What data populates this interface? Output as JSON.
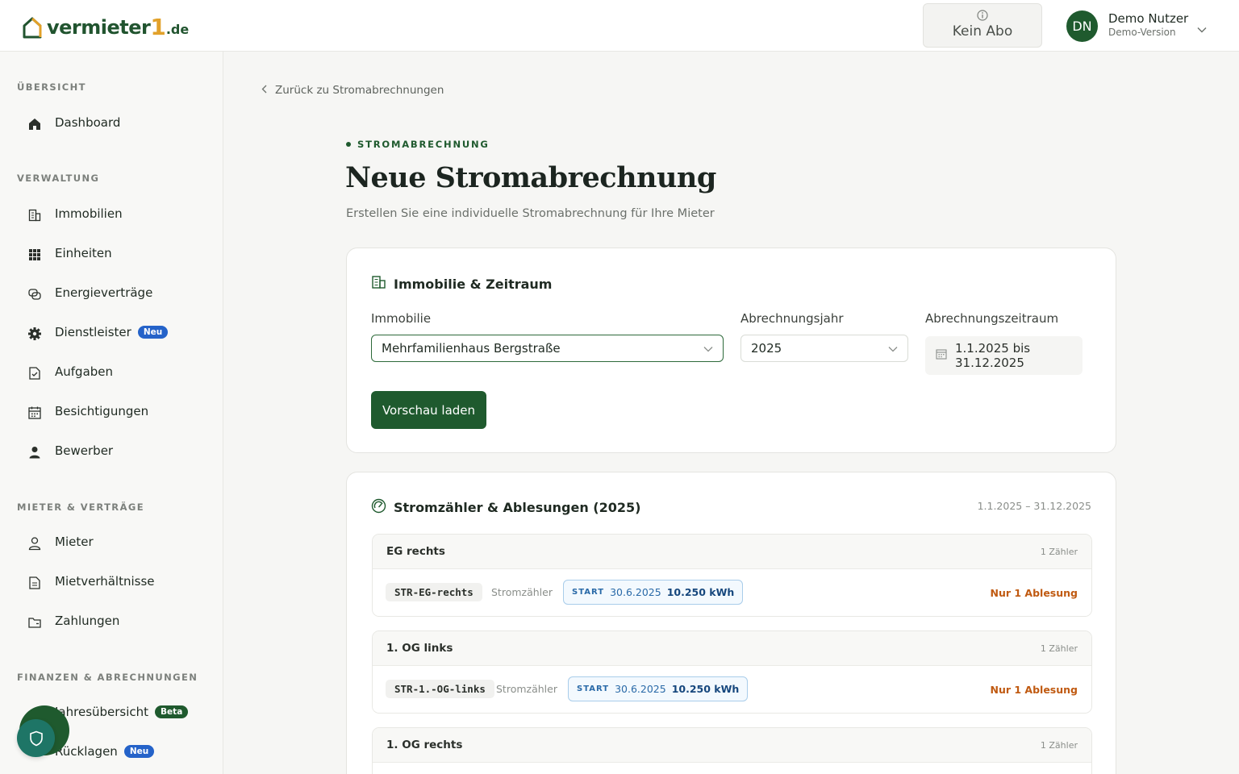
{
  "header": {
    "logo": {
      "text": "vermieter",
      "one": "1",
      "tld": ".de"
    },
    "subscription": {
      "label": "Kein Abo"
    },
    "user": {
      "initials": "DN",
      "name": "Demo Nutzer",
      "role": "Demo-Version"
    }
  },
  "sidebar": {
    "sections": [
      {
        "title": "ÜBERSICHT",
        "items": [
          {
            "label": "Dashboard",
            "icon": "home-icon"
          }
        ]
      },
      {
        "title": "VERWALTUNG",
        "items": [
          {
            "label": "Immobilien",
            "icon": "building-icon"
          },
          {
            "label": "Einheiten",
            "icon": "grid-icon"
          },
          {
            "label": "Energieverträge",
            "icon": "contract-icon"
          },
          {
            "label": "Dienstleister",
            "icon": "gear-icon",
            "badge": "Neu"
          },
          {
            "label": "Aufgaben",
            "icon": "task-icon"
          },
          {
            "label": "Besichtigungen",
            "icon": "calendar-icon"
          },
          {
            "label": "Bewerber",
            "icon": "person-icon"
          }
        ]
      },
      {
        "title": "MIETER & VERTRÄGE",
        "items": [
          {
            "label": "Mieter",
            "icon": "user-icon"
          },
          {
            "label": "Mietverhältnisse",
            "icon": "document-icon"
          },
          {
            "label": "Zahlungen",
            "icon": "wallet-icon"
          }
        ]
      },
      {
        "title": "FINANZEN & ABRECHNUNGEN",
        "items": [
          {
            "label": "Jahresübersicht",
            "icon": "chart-icon",
            "badge": "Beta"
          },
          {
            "label": "Rücklagen",
            "icon": "piggy-icon",
            "badge": "Neu"
          }
        ]
      }
    ]
  },
  "main": {
    "back_link": "Zurück zu Stromabrechnungen",
    "eyebrow": "STROMABRECHNUNG",
    "title": "Neue Stromabrechnung",
    "subtitle": "Erstellen Sie eine individuelle Stromabrechnung für Ihre Mieter",
    "property_card": {
      "title": "Immobilie & Zeitraum",
      "property_label": "Immobilie",
      "property_value": "Mehrfamilienhaus Bergstraße",
      "year_label": "Abrechnungsjahr",
      "year_value": "2025",
      "period_label": "Abrechnungszeitraum",
      "period_value": "1.1.2025 bis 31.12.2025",
      "button": "Vorschau laden"
    },
    "meters_card": {
      "title": "Stromzähler & Ablesungen (2025)",
      "date_range": "1.1.2025 – 31.12.2025",
      "units": [
        {
          "name": "EG rechts",
          "count": "1 Zähler",
          "meter_id": "STR-EG-rechts",
          "meter_type": "Stromzähler",
          "reading_tag": "START",
          "reading_date": "30.6.2025",
          "reading_value": "10.250 kWh",
          "status": "Nur 1 Ablesung"
        },
        {
          "name": "1. OG links",
          "count": "1 Zähler",
          "meter_id": "STR-1.-OG-links",
          "meter_type": "Stromzähler",
          "reading_tag": "START",
          "reading_date": "30.6.2025",
          "reading_value": "10.250 kWh",
          "status": "Nur 1 Ablesung"
        },
        {
          "name": "1. OG rechts",
          "count": "1 Zähler"
        }
      ]
    }
  },
  "colors": {
    "brand_green": "#1f5a2e",
    "accent_orange": "#e2a12a",
    "badge_blue": "#2563c9",
    "status_orange": "#c05a11",
    "reading_blue": "#2a6aa8"
  }
}
